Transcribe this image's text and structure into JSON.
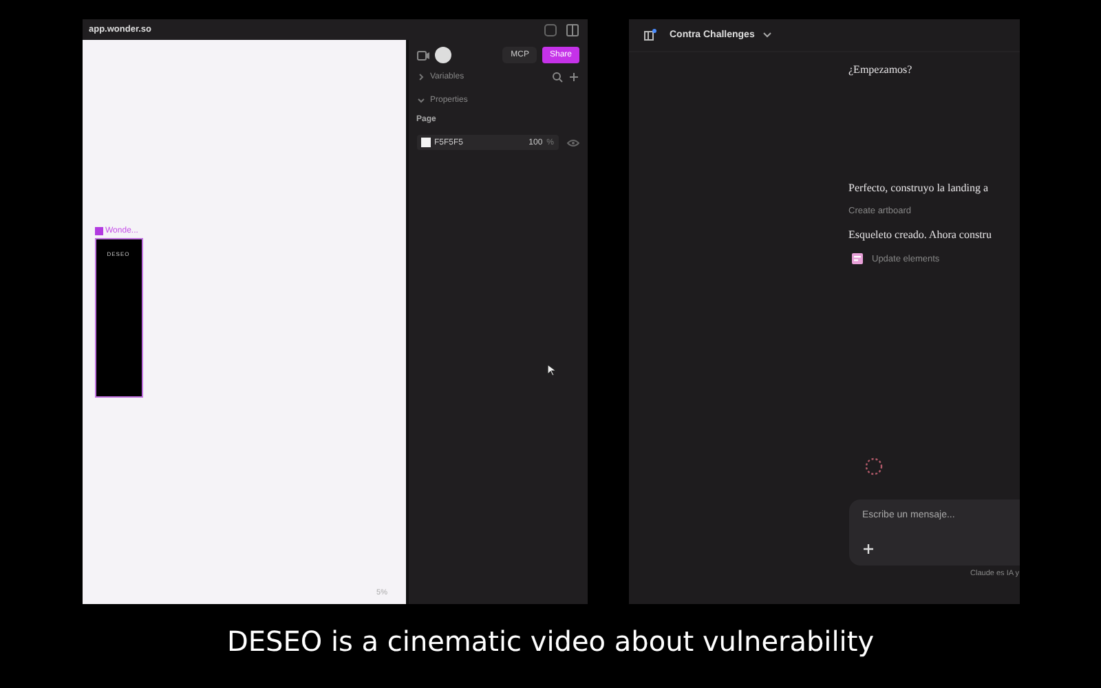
{
  "editor": {
    "url": "app.wonder.so",
    "toolbar": {
      "mcp": "MCP",
      "share": "Share"
    },
    "sections": [
      {
        "label": "Variables",
        "expanded": false
      },
      {
        "label": "Properties",
        "expanded": true
      }
    ],
    "page_label": "Page",
    "fill": {
      "hex": "F5F5F5",
      "opacity": "100",
      "unit": "%"
    },
    "artboard": {
      "label": "Wonde...",
      "text": "DESEO"
    },
    "zoom": "5%"
  },
  "chat": {
    "title": "Contra Challenges",
    "messages": [
      {
        "kind": "text",
        "text": "¿Empezamos?"
      },
      {
        "kind": "text",
        "text": "Perfecto, construyo la landing a"
      },
      {
        "kind": "tool",
        "text": "Create artboard"
      },
      {
        "kind": "text",
        "text": "Esqueleto creado. Ahora constru"
      },
      {
        "kind": "action",
        "text": "Update elements"
      }
    ],
    "input": {
      "placeholder": "Escribe un mensaje..."
    },
    "disclaimer": "Claude es IA y"
  },
  "caption": "DESEO is a cinematic video about vulnerability"
}
